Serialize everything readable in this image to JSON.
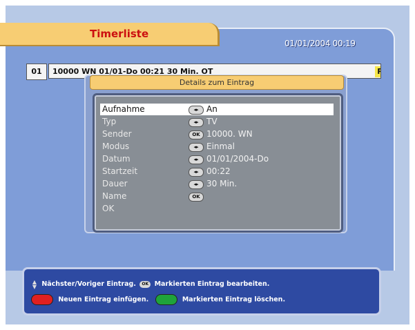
{
  "header": {
    "title": "Timerliste",
    "datetime": "01/01/2004 00:19"
  },
  "timer_list": {
    "rows": [
      {
        "number": "01",
        "entry": "10000 WN     01/01-Do     00:21     30 Min.   OT",
        "flag": "R"
      }
    ]
  },
  "dialog": {
    "title": "Details zum Eintrag",
    "params": [
      {
        "label": "Aufnahme",
        "value": "An",
        "control": "◂▸",
        "selected": true
      },
      {
        "label": "Typ",
        "value": "TV",
        "control": "◂▸",
        "selected": false
      },
      {
        "label": "Sender",
        "value": "10000. WN",
        "control": "OK",
        "selected": false
      },
      {
        "label": "Modus",
        "value": "Einmal",
        "control": "◂▸",
        "selected": false
      },
      {
        "label": "Datum",
        "value": "01/01/2004-Do",
        "control": "◂▸",
        "selected": false
      },
      {
        "label": "Startzeit",
        "value": "00:22",
        "control": "◂▸",
        "selected": false
      },
      {
        "label": "Dauer",
        "value": "30 Min.",
        "control": "◂▸",
        "selected": false
      },
      {
        "label": "Name",
        "value": "",
        "control": "OK",
        "selected": false
      },
      {
        "label": "OK",
        "value": "",
        "control": "",
        "selected": false
      }
    ]
  },
  "help": {
    "nav": "Nächster/Voriger Eintrag.",
    "ok_key": "OK",
    "ok": "Markierten Eintrag bearbeiten.",
    "red": "Neuen Eintrag einfügen.",
    "green": "Markierten Eintrag löschen."
  },
  "colors": {
    "panel": "#7f9dd8",
    "title_tab": "#f7cd73",
    "title_text": "#cc1010",
    "red_key": "#e02020",
    "green_key": "#1fa33a"
  }
}
